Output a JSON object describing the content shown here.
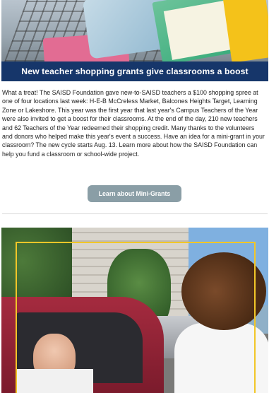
{
  "article": {
    "hero_image_alt": "Shopping cart filled with school supplies",
    "headline": "New teacher shopping grants give classrooms a boost",
    "body": "What a treat! The SAISD Foundation gave new-to-SAISD teachers a $100 shopping spree at one of four locations last week: H-E-B McCreless Market, Balcones Heights Target, Learning Zone or Lakeshore. This year was the first year that last year's Campus Teachers of the Year were also invited to get a boost for their classrooms. At the end of the day, 210 new teachers and 62 Teachers of the Year redeemed their shopping credit. Many thanks to the volunteers and donors who helped make this year's event a success. Have an idea for a mini-grant in your classroom? The new cycle starts Aug. 13. Learn more about how the SAISD Foundation can help you fund a classroom or school-wide project.",
    "cta_label": "Learn about Mini-Grants"
  },
  "next_article": {
    "photo_alt": "Teacher in a car greeted by a volunteer"
  },
  "colors": {
    "headline_bg": "#16366a",
    "cta_bg": "#8a9ea6",
    "frame": "#f2c628"
  }
}
